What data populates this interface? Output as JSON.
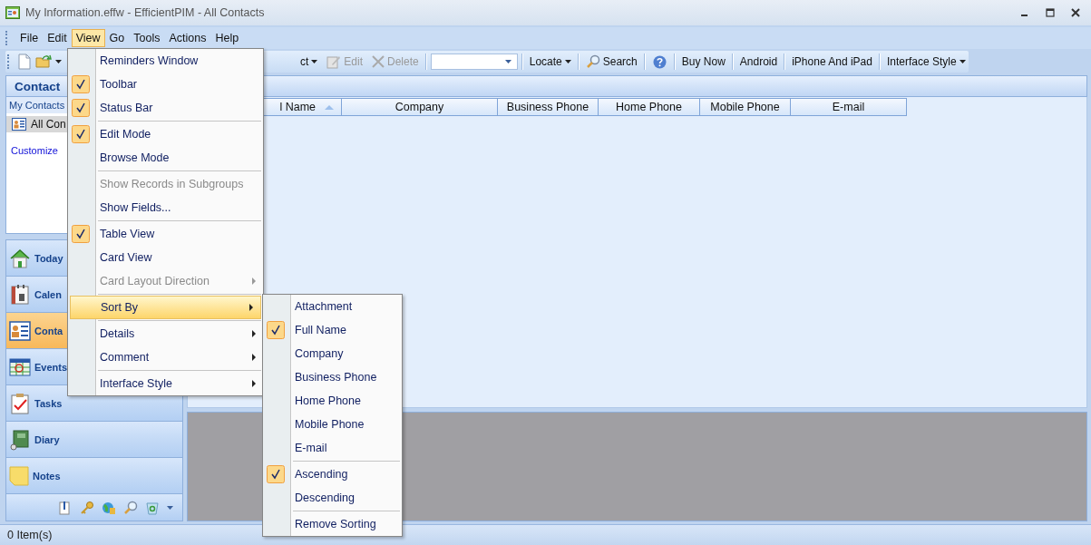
{
  "window": {
    "title": "My Information.effw - EfficientPIM - All Contacts"
  },
  "menu_bar": [
    {
      "label": "File",
      "selected": false
    },
    {
      "label": "Edit",
      "selected": false
    },
    {
      "label": "View",
      "selected": true
    },
    {
      "label": "Go",
      "selected": false
    },
    {
      "label": "Tools",
      "selected": false
    },
    {
      "label": "Actions",
      "selected": false
    },
    {
      "label": "Help",
      "selected": false
    }
  ],
  "toolbar": {
    "partial_label": "ct",
    "edit": {
      "label": "Edit",
      "disabled": true
    },
    "delete": {
      "label": "Delete",
      "disabled": true
    },
    "locate": "Locate",
    "search": "Search",
    "links": [
      "Buy Now",
      "Android",
      "iPhone And iPad"
    ],
    "interface_style": "Interface Style"
  },
  "sidebar": {
    "title": "Contact",
    "section": "My Contacts",
    "items": [
      {
        "label": "All Con",
        "selected": true
      }
    ],
    "link": "Customize",
    "nav": [
      {
        "label": "Today",
        "selected": false
      },
      {
        "label": "Calen",
        "selected": false
      },
      {
        "label": "Conta",
        "selected": true
      },
      {
        "label": "Events",
        "selected": false
      },
      {
        "label": "Tasks",
        "selected": false
      },
      {
        "label": "Diary",
        "selected": false
      },
      {
        "label": "Notes",
        "selected": false
      }
    ]
  },
  "table": {
    "columns": [
      {
        "label": "l Name",
        "sorted": true
      },
      {
        "label": "Company",
        "sorted": false
      },
      {
        "label": "Business Phone",
        "sorted": false
      },
      {
        "label": "Home Phone",
        "sorted": false
      },
      {
        "label": "Mobile Phone",
        "sorted": false
      },
      {
        "label": "E-mail",
        "sorted": false
      }
    ]
  },
  "view_menu": {
    "items": [
      {
        "kind": "item",
        "label": "Reminders Window",
        "checked": false,
        "disabled": false,
        "submenu": false,
        "selected": false
      },
      {
        "kind": "item",
        "label": "Toolbar",
        "checked": true,
        "disabled": false,
        "submenu": false,
        "selected": false
      },
      {
        "kind": "item",
        "label": "Status Bar",
        "checked": true,
        "disabled": false,
        "submenu": false,
        "selected": false
      },
      {
        "kind": "separator"
      },
      {
        "kind": "item",
        "label": "Edit Mode",
        "checked": true,
        "disabled": false,
        "submenu": false,
        "selected": false
      },
      {
        "kind": "item",
        "label": "Browse Mode",
        "checked": false,
        "disabled": false,
        "submenu": false,
        "selected": false
      },
      {
        "kind": "separator"
      },
      {
        "kind": "item",
        "label": "Show Records in Subgroups",
        "checked": false,
        "disabled": true,
        "submenu": false,
        "selected": false
      },
      {
        "kind": "item",
        "label": "Show Fields...",
        "checked": false,
        "disabled": false,
        "submenu": false,
        "selected": false
      },
      {
        "kind": "separator"
      },
      {
        "kind": "item",
        "label": "Table View",
        "checked": true,
        "disabled": false,
        "submenu": false,
        "selected": false
      },
      {
        "kind": "item",
        "label": "Card View",
        "checked": false,
        "disabled": false,
        "submenu": false,
        "selected": false
      },
      {
        "kind": "item",
        "label": "Card Layout Direction",
        "checked": false,
        "disabled": true,
        "submenu": true,
        "selected": false
      },
      {
        "kind": "separator"
      },
      {
        "kind": "item",
        "label": "Sort By",
        "checked": false,
        "disabled": false,
        "submenu": true,
        "selected": true
      },
      {
        "kind": "separator"
      },
      {
        "kind": "item",
        "label": "Details",
        "checked": false,
        "disabled": false,
        "submenu": true,
        "selected": false
      },
      {
        "kind": "item",
        "label": "Comment",
        "checked": false,
        "disabled": false,
        "submenu": true,
        "selected": false
      },
      {
        "kind": "separator"
      },
      {
        "kind": "item",
        "label": "Interface Style",
        "checked": false,
        "disabled": false,
        "submenu": true,
        "selected": false
      }
    ]
  },
  "sort_menu": {
    "items": [
      {
        "kind": "item",
        "label": "Attachment",
        "checked": false
      },
      {
        "kind": "item",
        "label": "Full Name",
        "checked": true
      },
      {
        "kind": "item",
        "label": "Company",
        "checked": false
      },
      {
        "kind": "item",
        "label": "Business Phone",
        "checked": false
      },
      {
        "kind": "item",
        "label": "Home Phone",
        "checked": false
      },
      {
        "kind": "item",
        "label": "Mobile Phone",
        "checked": false
      },
      {
        "kind": "item",
        "label": "E-mail",
        "checked": false
      },
      {
        "kind": "separator"
      },
      {
        "kind": "item",
        "label": "Ascending",
        "checked": true
      },
      {
        "kind": "item",
        "label": "Descending",
        "checked": false
      },
      {
        "kind": "separator"
      },
      {
        "kind": "item",
        "label": "Remove Sorting",
        "checked": false
      }
    ]
  },
  "status_bar": {
    "text": "0 Item(s)"
  }
}
